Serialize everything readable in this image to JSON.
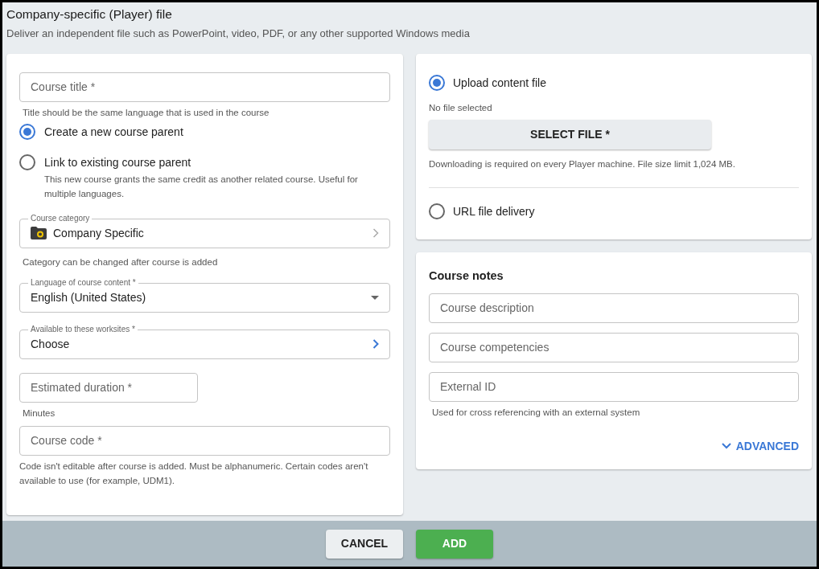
{
  "header": {
    "title": "Company-specific (Player) file",
    "subtitle": "Deliver an independent file such as PowerPoint, video, PDF, or any other supported Windows media"
  },
  "course_title": {
    "placeholder": "Course title *",
    "helper": "Title should be the same language that is used in the course"
  },
  "parent_options": [
    {
      "label": "Create a new course parent",
      "selected": true
    },
    {
      "label": "Link to existing course parent",
      "selected": false,
      "description": "This new course grants the same credit as another related course. Useful for multiple languages."
    }
  ],
  "course_category": {
    "label": "Course category",
    "value": "Company Specific",
    "helper": "Category can be changed after course is added"
  },
  "language": {
    "label": "Language of course content *",
    "value": "English (United States)"
  },
  "worksites": {
    "label": "Available to these worksites *",
    "value": "Choose"
  },
  "duration": {
    "placeholder": "Estimated duration *",
    "helper": "Minutes"
  },
  "course_code": {
    "placeholder": "Course code *",
    "helper": "Code isn't editable after course is added. Must be alphanumeric. Certain codes aren't available to use (for example, UDM1)."
  },
  "delivery_options": [
    {
      "kind": "upload",
      "label": "Upload content file",
      "selected": true,
      "status": "No file selected",
      "button": "SELECT FILE *",
      "helper": "Downloading is required on every Player machine. File size limit 1,024 MB."
    },
    {
      "kind": "url",
      "label": "URL file delivery",
      "selected": false
    }
  ],
  "course_notes": {
    "title": "Course notes",
    "fields": [
      {
        "placeholder": "Course description"
      },
      {
        "placeholder": "Course competencies"
      },
      {
        "placeholder": "External ID",
        "helper": "Used for cross referencing with an external system"
      }
    ],
    "advanced": "ADVANCED"
  },
  "footer": {
    "cancel": "CANCEL",
    "add": "ADD"
  }
}
